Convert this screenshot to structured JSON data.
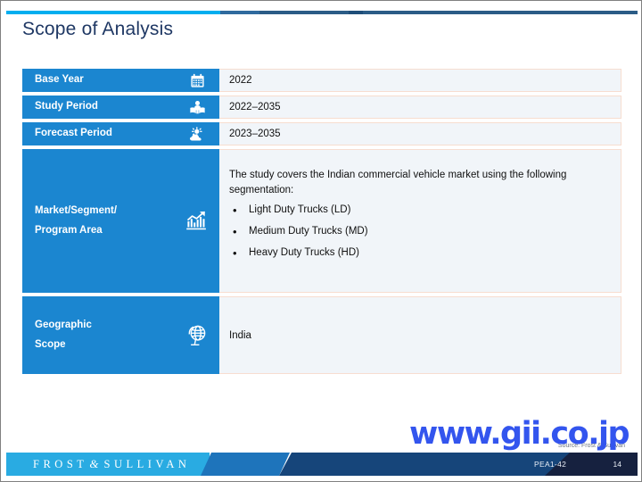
{
  "slide": {
    "title": "Scope of Analysis",
    "accent_cyan": "#00aeef",
    "accent_blue": "#1b86d0",
    "title_color": "#1f3864"
  },
  "table": {
    "rows": [
      {
        "label": "Base Year",
        "label_line2": "",
        "icon": "calendar-icon",
        "value": "2022",
        "type": "simple"
      },
      {
        "label": "Study Period",
        "label_line2": "",
        "icon": "person-reading-book-icon",
        "value": "2022–2035",
        "type": "simple"
      },
      {
        "label": "Forecast Period",
        "label_line2": "",
        "icon": "sun-cloud-forecast-icon",
        "value": "2023–2035",
        "type": "simple"
      },
      {
        "label": "Market/Segment/",
        "label_line2": "Program Area",
        "icon": "bar-chart-growth-icon",
        "value": "",
        "type": "block",
        "intro": "The study covers the Indian commercial vehicle market using the following segmentation:",
        "bullets": [
          "Light Duty Trucks (LD)",
          "Medium Duty Trucks (MD)",
          "Heavy Duty Trucks (HD)"
        ]
      },
      {
        "label": "Geographic",
        "label_line2": "Scope",
        "icon": "globe-stand-icon",
        "value": "India",
        "type": "geo"
      }
    ]
  },
  "source_note": "Source: Frost & Sullivan",
  "watermark": "www.gii.co.jp",
  "footer": {
    "brand_first": "FROST",
    "brand_amp": "&",
    "brand_last": "SULLIVAN",
    "doc_code": "PEA1-42",
    "page_number": "14"
  }
}
